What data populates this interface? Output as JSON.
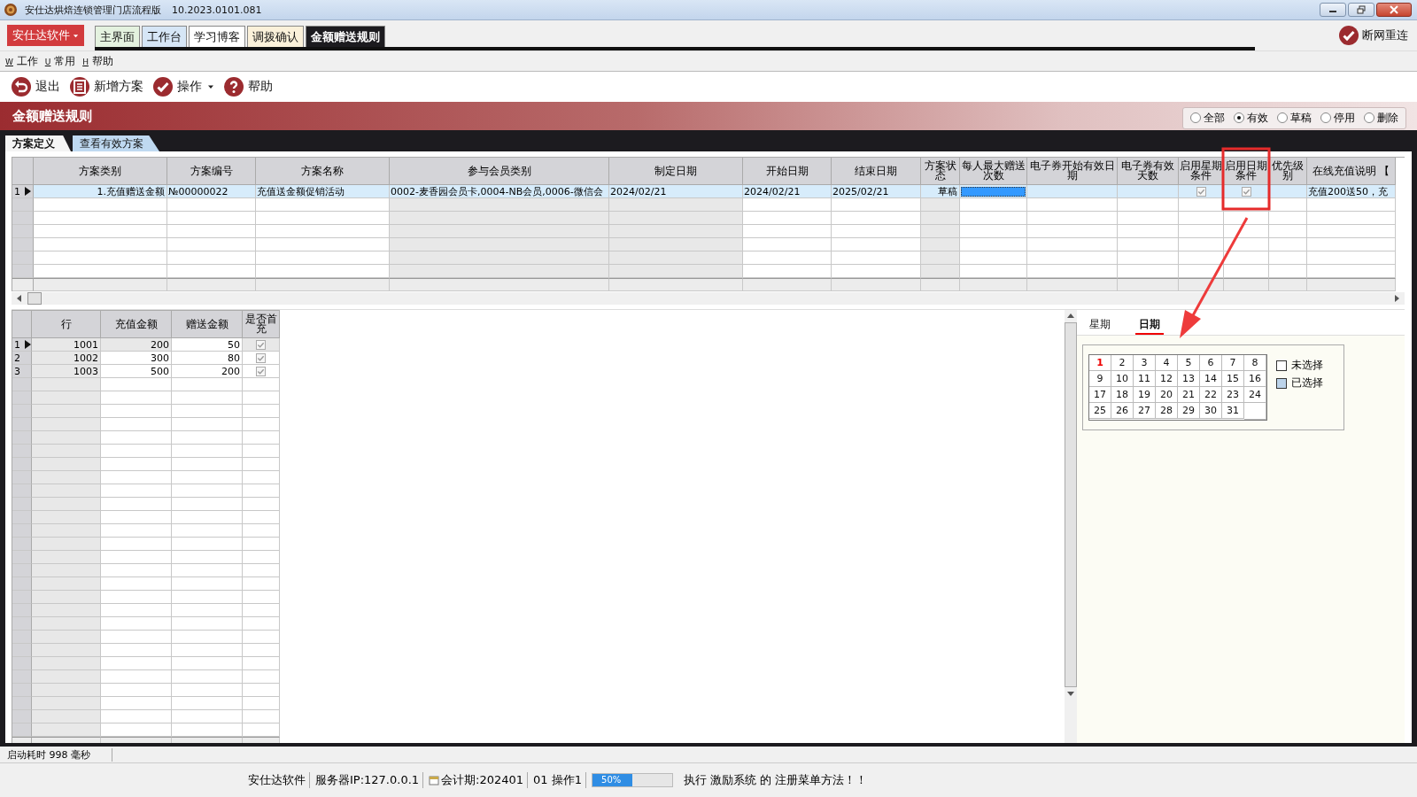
{
  "window": {
    "title": "安仕达烘焙连锁管理门店流程版",
    "version": "10.2023.0101.081"
  },
  "brand_menu": {
    "label": "安仕达软件"
  },
  "tabs": [
    {
      "label": "主界面",
      "selected": false,
      "color": "#e4f2df"
    },
    {
      "label": "工作台",
      "selected": false,
      "color": "#d6e6f6"
    },
    {
      "label": "学习博客",
      "selected": false,
      "color": "#ffffff"
    },
    {
      "label": "调拨确认",
      "selected": false,
      "color": "#fbf1da"
    },
    {
      "label": "金额赠送规则",
      "selected": true,
      "color": "#1c1b1f"
    }
  ],
  "reconnect": {
    "label": "断网重连"
  },
  "menu": [
    {
      "key": "W",
      "label": "工作"
    },
    {
      "key": "U",
      "label": "常用"
    },
    {
      "key": "H",
      "label": "帮助"
    }
  ],
  "toolbar": [
    {
      "label": "退出",
      "dropdown": false
    },
    {
      "label": "新增方案",
      "dropdown": false
    },
    {
      "label": "操作",
      "dropdown": true
    },
    {
      "label": "帮助",
      "dropdown": false
    }
  ],
  "page_title": "金额赠送规则",
  "status_filter": [
    {
      "label": "全部",
      "selected": false
    },
    {
      "label": "有效",
      "selected": true
    },
    {
      "label": "草稿",
      "selected": false
    },
    {
      "label": "停用",
      "selected": false
    },
    {
      "label": "删除",
      "selected": false
    }
  ],
  "subtabs": [
    {
      "label": "方案定义",
      "selected": true
    },
    {
      "label": "查看有效方案",
      "selected": false
    }
  ],
  "plan_table": {
    "columns": [
      "方案类别",
      "方案编号",
      "方案名称",
      "参与会员类别",
      "制定日期",
      "开始日期",
      "结束日期",
      "方案状态",
      "每人最大赠送次数",
      "电子券开始有效日期",
      "电子券有效天数",
      "启用星期条件",
      "启用日期条件",
      "优先级别",
      "在线充值说明 【"
    ],
    "rows": [
      {
        "number": "1",
        "selected": true,
        "cells": [
          {
            "text": "1.充值赠送金额"
          },
          {
            "text": "№00000022"
          },
          {
            "text": "充值送金额促销活动"
          },
          {
            "text": "0002-麦香园会员卡,0004-NB会员,0006-微信会"
          },
          {
            "text": "2024/02/21"
          },
          {
            "text": "2024/02/21"
          },
          {
            "text": "2025/02/21"
          },
          {
            "text": "草稿"
          },
          {
            "current": true
          },
          null,
          null,
          {
            "checked": true
          },
          {
            "checked": true
          },
          null,
          {
            "text": "充值200送50，充"
          }
        ]
      }
    ]
  },
  "detail_table": {
    "columns": [
      "行",
      "充值金额",
      "赠送金额",
      "是否首充"
    ],
    "rows": [
      {
        "number": "1",
        "selected": true,
        "cells": [
          "1001",
          "200",
          "50",
          {
            "checked": true
          }
        ]
      },
      {
        "number": "2",
        "selected": false,
        "cells": [
          "1002",
          "300",
          "80",
          {
            "checked": true
          }
        ]
      },
      {
        "number": "3",
        "selected": false,
        "cells": [
          "1003",
          "500",
          "200",
          {
            "checked": true
          }
        ]
      }
    ]
  },
  "date_panel": {
    "tabs": [
      {
        "label": "星期",
        "selected": false
      },
      {
        "label": "日期",
        "selected": true
      }
    ],
    "days": [
      {
        "day": "1",
        "current": true,
        "selected": false
      },
      {
        "day": "2",
        "current": false,
        "selected": false
      },
      {
        "day": "3",
        "current": false,
        "selected": false
      },
      {
        "day": "4",
        "current": false,
        "selected": false
      },
      {
        "day": "5",
        "current": false,
        "selected": false
      },
      {
        "day": "6",
        "current": false,
        "selected": false
      },
      {
        "day": "7",
        "current": false,
        "selected": false
      },
      {
        "day": "8",
        "current": false,
        "selected": false
      },
      {
        "day": "9",
        "current": false,
        "selected": false
      },
      {
        "day": "10",
        "current": false,
        "selected": false
      },
      {
        "day": "11",
        "current": false,
        "selected": false
      },
      {
        "day": "12",
        "current": false,
        "selected": false
      },
      {
        "day": "13",
        "current": false,
        "selected": false
      },
      {
        "day": "14",
        "current": false,
        "selected": false
      },
      {
        "day": "15",
        "current": false,
        "selected": false
      },
      {
        "day": "16",
        "current": false,
        "selected": false
      },
      {
        "day": "17",
        "current": false,
        "selected": false
      },
      {
        "day": "18",
        "current": false,
        "selected": false
      },
      {
        "day": "19",
        "current": false,
        "selected": false
      },
      {
        "day": "20",
        "current": false,
        "selected": false
      },
      {
        "day": "21",
        "current": false,
        "selected": false
      },
      {
        "day": "22",
        "current": false,
        "selected": false
      },
      {
        "day": "23",
        "current": false,
        "selected": false
      },
      {
        "day": "24",
        "current": false,
        "selected": false
      },
      {
        "day": "25",
        "current": false,
        "selected": false
      },
      {
        "day": "26",
        "current": false,
        "selected": false
      },
      {
        "day": "27",
        "current": false,
        "selected": false
      },
      {
        "day": "28",
        "current": false,
        "selected": false
      },
      {
        "day": "29",
        "current": false,
        "selected": false
      },
      {
        "day": "30",
        "current": false,
        "selected": false
      },
      {
        "day": "31",
        "current": false,
        "selected": false
      }
    ],
    "legend": [
      {
        "label": "未选择",
        "selected": false
      },
      {
        "label": "已选择",
        "selected": true
      }
    ]
  },
  "status_bar": {
    "startup": "启动耗时 998 毫秒",
    "items": [
      "安仕达软件",
      "服务器IP:127.0.0.1",
      "会计期:202401",
      "01 操作1"
    ],
    "progress": {
      "level": 0.5,
      "label": "50%"
    },
    "message": "执行 激励系统 的 注册菜单方法！！"
  }
}
